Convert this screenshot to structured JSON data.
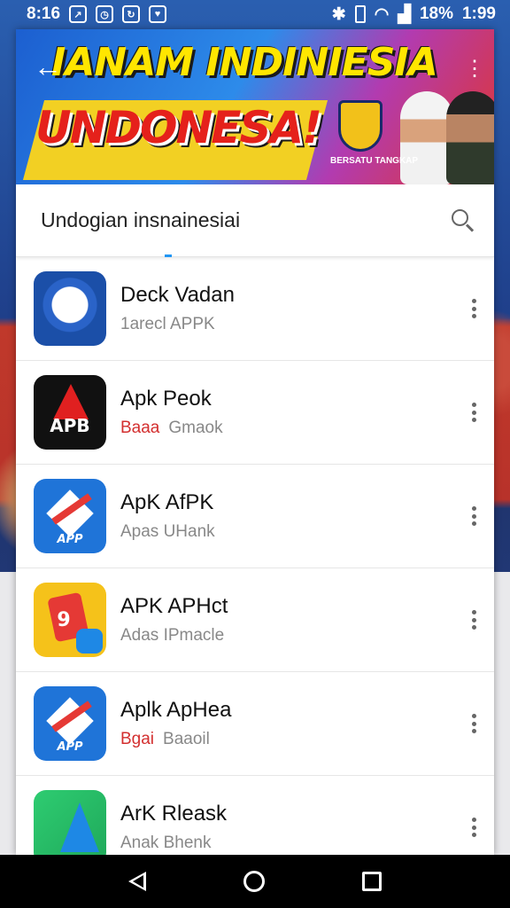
{
  "status_bar": {
    "time": "8:16",
    "battery": "18%",
    "clock_right": "1:99"
  },
  "banner": {
    "line1": "IANAM INDINIESIA",
    "line2": "UNDONESA!",
    "caption": "BERSATU TANGKAP"
  },
  "search": {
    "query": "Undogian insnainesiai"
  },
  "apps": [
    {
      "title": "Deck Vadan",
      "sub_red": "",
      "sub": "1arecl APPK",
      "icon": "blue-badge-icon",
      "glyph": ""
    },
    {
      "title": "Apk Peok",
      "sub_red": "Baaa",
      "sub": "Gmaok",
      "icon": "apk-black-icon",
      "glyph": "APB"
    },
    {
      "title": "ApK AfPK",
      "sub_red": "",
      "sub": "Apas UHank",
      "icon": "apk-blue-icon",
      "glyph": "APP"
    },
    {
      "title": "APK APHct",
      "sub_red": "",
      "sub": "Adas IPmacle",
      "icon": "apk-yellow-icon",
      "glyph": "9"
    },
    {
      "title": "Aplk ApHea",
      "sub_red": "Bgai",
      "sub": "Baaoil",
      "icon": "apk-blue-icon",
      "glyph": "APP"
    },
    {
      "title": "ArK Rleask",
      "sub_red": "",
      "sub": "Anak Bhenk",
      "icon": "apk-green-icon",
      "glyph": ""
    }
  ],
  "colors": {
    "accent": "#2196f3",
    "banner_yellow": "#ffe600",
    "banner_red": "#e5211b"
  }
}
